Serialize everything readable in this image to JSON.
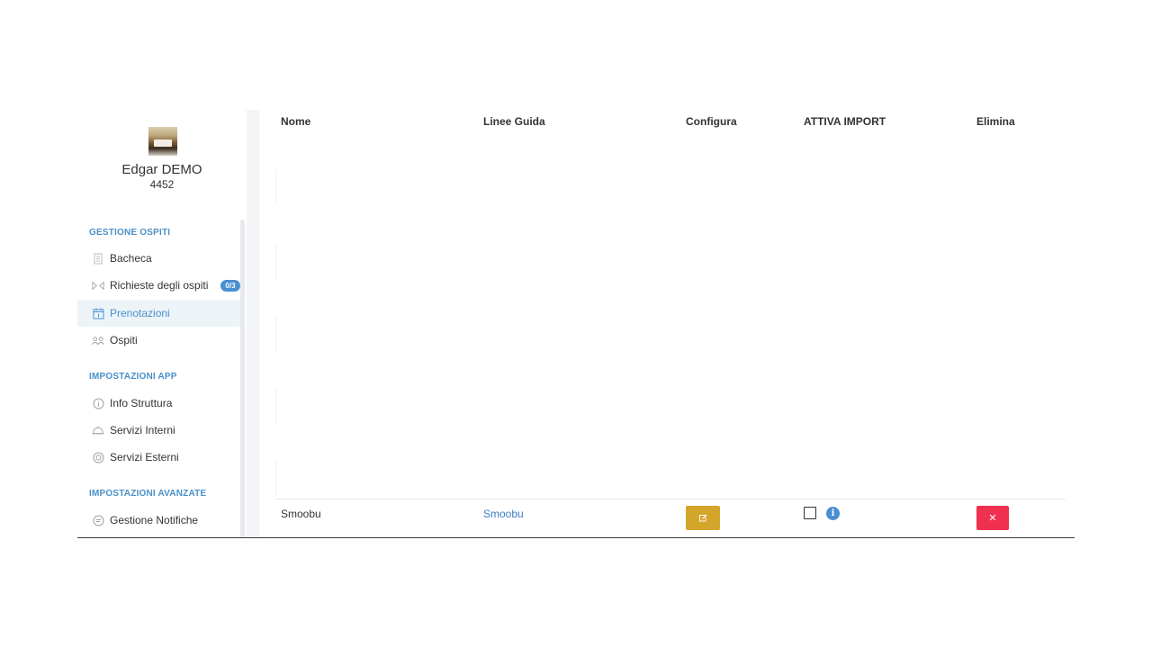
{
  "user": {
    "name": "Edgar DEMO",
    "code": "4452"
  },
  "sections": {
    "guests": "GESTIONE OSPITI",
    "app_settings": "IMPOSTAZIONI APP",
    "advanced_settings": "IMPOSTAZIONI AVANZATE"
  },
  "nav": {
    "bacheca": "Bacheca",
    "richieste": "Richieste degli ospiti",
    "richieste_badge": "0/3",
    "prenotazioni": "Prenotazioni",
    "ospiti": "Ospiti",
    "info_struttura": "Info Struttura",
    "servizi_interni": "Servizi Interni",
    "servizi_esterni": "Servizi Esterni",
    "gestione_notifiche": "Gestione Notifiche"
  },
  "table": {
    "headers": {
      "nome": "Nome",
      "linee_guida": "Linee Guida",
      "configura": "Configura",
      "attiva_import": "ATTIVA IMPORT",
      "elimina": "Elimina"
    },
    "rows": [
      {
        "nome": "Smoobu",
        "linee_guida": "Smoobu",
        "attiva_import": false
      }
    ]
  },
  "icons": {
    "configure": "edit-icon",
    "delete": "close-icon",
    "info": "info-icon"
  },
  "colors": {
    "accent": "#4a8fd0",
    "configure_button": "#d4a52b",
    "delete_button": "#f0304f",
    "link": "#3b7fc1"
  }
}
